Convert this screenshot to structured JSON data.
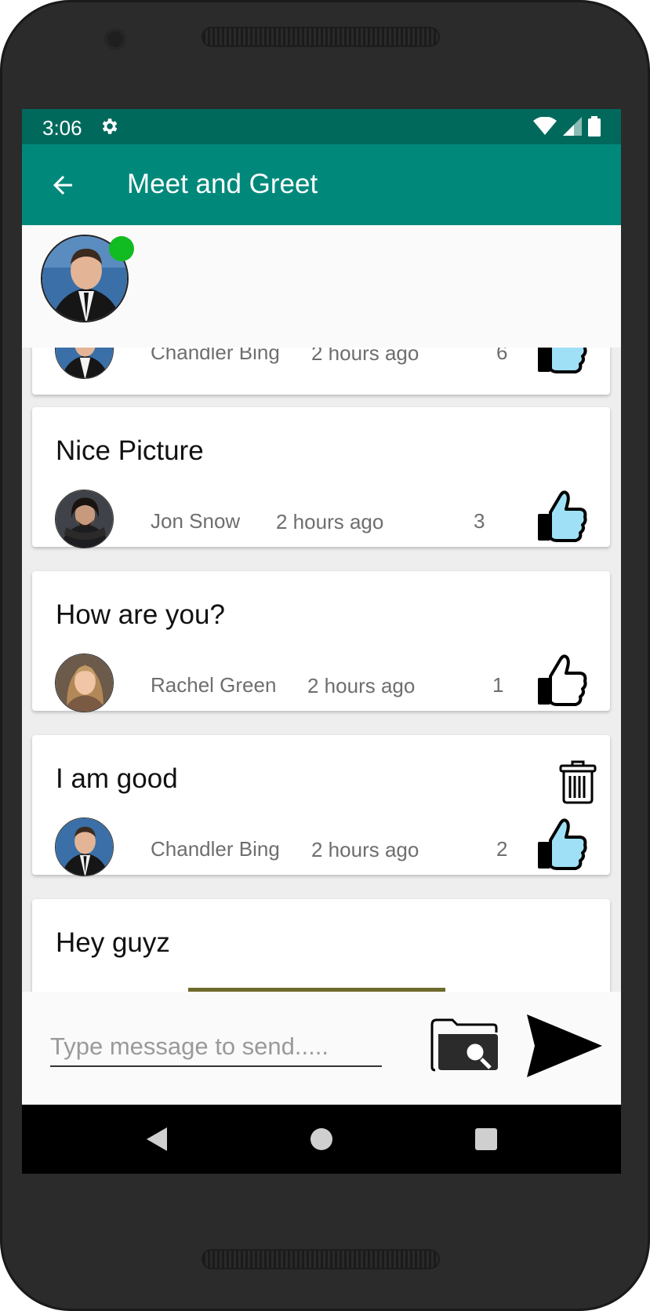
{
  "status_bar": {
    "time": "3:06",
    "icons": [
      "gear-icon",
      "wifi-icon",
      "signal-icon",
      "battery-icon"
    ]
  },
  "app_bar": {
    "title": "Meet and Greet",
    "back_icon": "arrow-left-icon"
  },
  "header": {
    "online": true,
    "online_color": "#11bb22"
  },
  "messages": [
    {
      "text": "",
      "author": "Chandler Bing",
      "time": "2 hours ago",
      "likes": "6",
      "liked": true
    },
    {
      "text": "Nice Picture",
      "author": "Jon Snow",
      "time": "2 hours ago",
      "likes": "3",
      "liked": true
    },
    {
      "text": "How are you?",
      "author": "Rachel Green",
      "time": "2 hours ago",
      "likes": "1",
      "liked": false
    },
    {
      "text": "I am good",
      "author": "Chandler Bing",
      "time": "2 hours ago",
      "likes": "2",
      "liked": true,
      "deletable": true
    },
    {
      "text": "Hey guyz"
    }
  ],
  "composer": {
    "placeholder": "Type message to send....."
  },
  "colors": {
    "status_bar": "#00695c",
    "app_bar": "#00897b",
    "like_fill": "#9fe0f7"
  }
}
